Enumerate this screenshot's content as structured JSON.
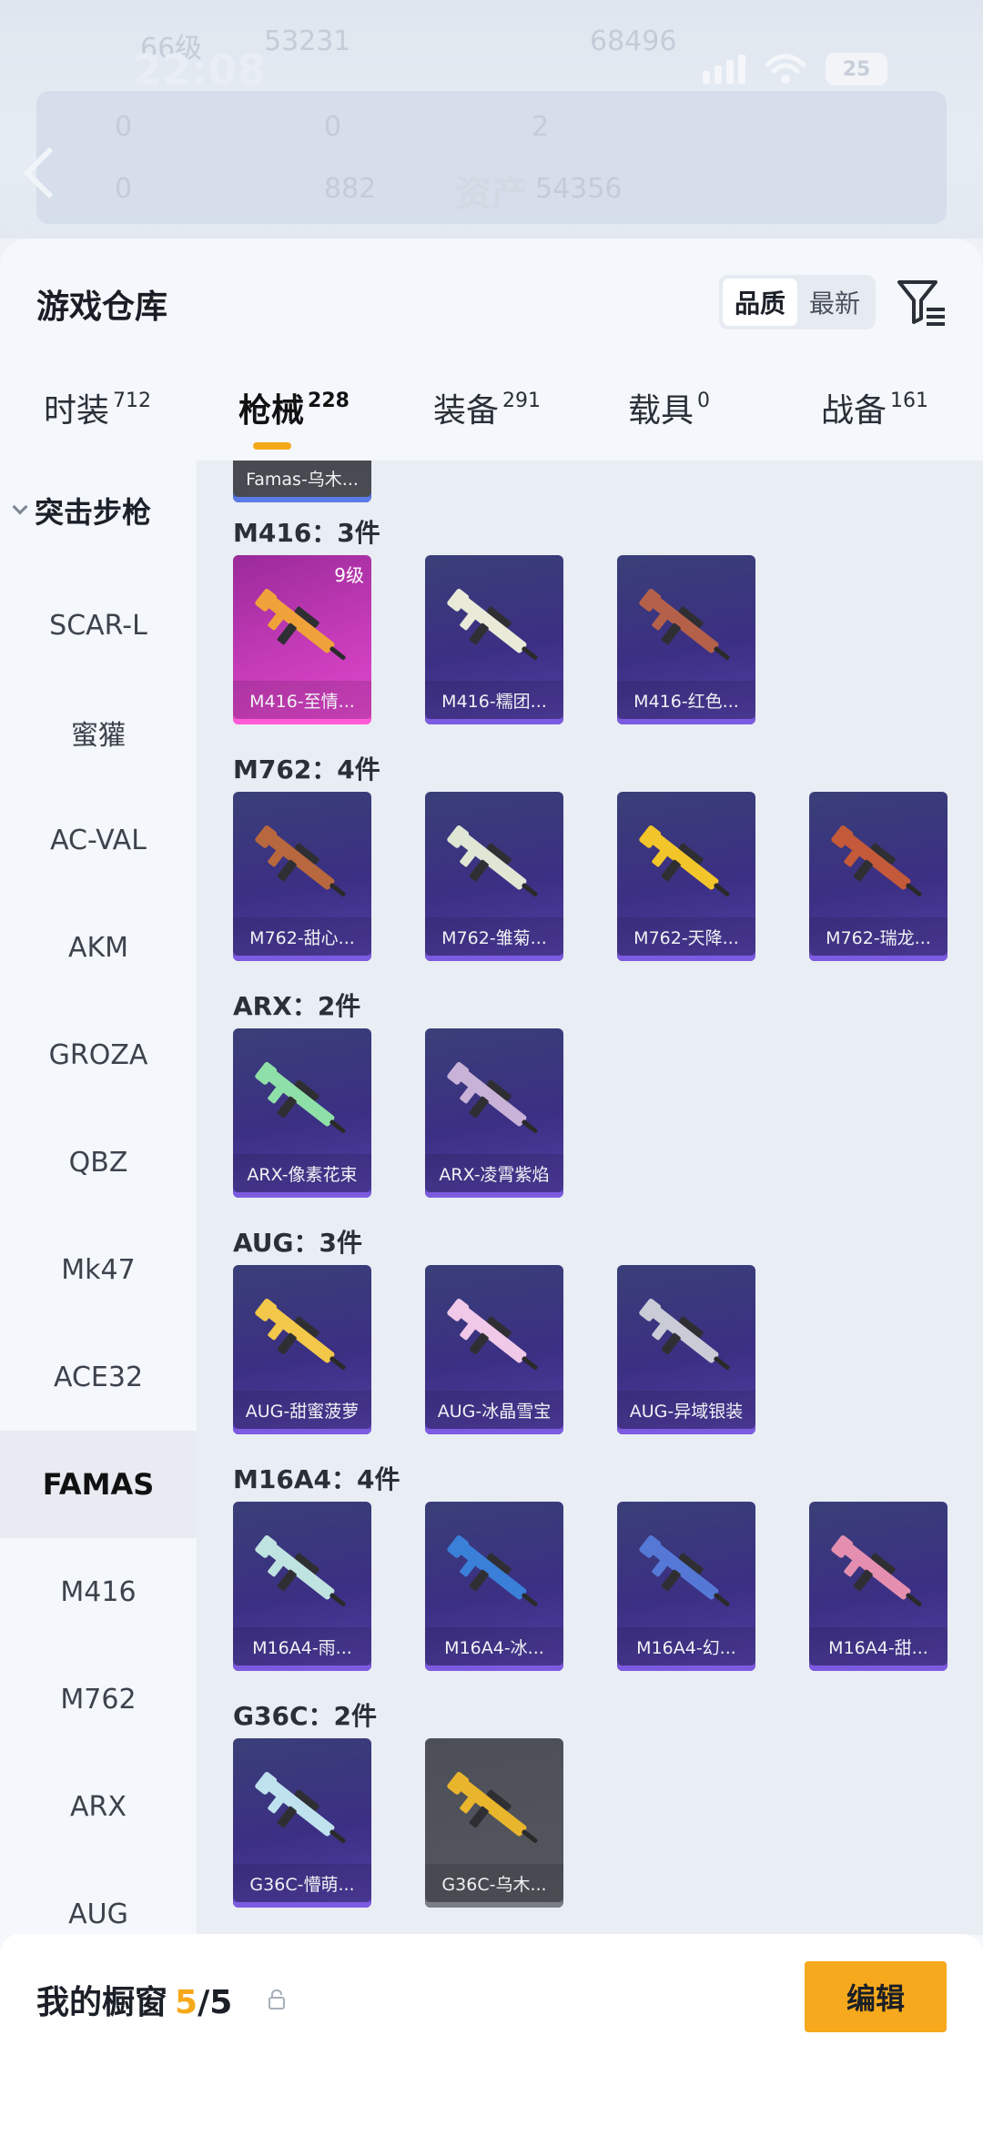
{
  "status_bar": {
    "time": "22:08",
    "battery": "25"
  },
  "backdrop": {
    "level_text": "66级",
    "coins_left": "53231",
    "coins_right": "68496",
    "stat_1": "0",
    "stat_2": "0",
    "stat_3": "2",
    "stat_4": "0",
    "stat_5": "882",
    "assets_label": "资产",
    "assets_value": "54356"
  },
  "header": {
    "title": "游戏仓库",
    "sort_options": [
      "品质",
      "最新"
    ],
    "sort_active": "品质"
  },
  "tabs": [
    {
      "label": "时装",
      "count": "712"
    },
    {
      "label": "枪械",
      "count": "228"
    },
    {
      "label": "装备",
      "count": "291"
    },
    {
      "label": "载具",
      "count": "0"
    },
    {
      "label": "战备",
      "count": "161"
    }
  ],
  "sidebar": {
    "section": "突击步枪",
    "items": [
      "SCAR-L",
      "蜜獾",
      "AC-VAL",
      "AKM",
      "GROZA",
      "QBZ",
      "Mk47",
      "ACE32",
      "FAMAS",
      "M416",
      "M762",
      "ARX",
      "AUG"
    ],
    "active": "FAMAS"
  },
  "content": {
    "partial_top_card": "Famas-乌木...",
    "groups": [
      {
        "title": "M416：3件",
        "items": [
          {
            "name": "M416-至情...",
            "level": "9级",
            "style": "pink",
            "color": "#f0a23a"
          },
          {
            "name": "M416-糯团...",
            "style": "purple",
            "color": "#e9ead8"
          },
          {
            "name": "M416-红色...",
            "style": "purple",
            "color": "#b5614a"
          }
        ]
      },
      {
        "title": "M762：4件",
        "items": [
          {
            "name": "M762-甜心...",
            "style": "purple",
            "color": "#b8683e"
          },
          {
            "name": "M762-雏菊...",
            "style": "purple",
            "color": "#dfe6d4"
          },
          {
            "name": "M762-天降...",
            "style": "purple",
            "color": "#f2c52b"
          },
          {
            "name": "M762-瑞龙...",
            "style": "purple",
            "color": "#c45a3a"
          }
        ]
      },
      {
        "title": "ARX：2件",
        "items": [
          {
            "name": "ARX-像素花束",
            "style": "purple",
            "color": "#8fe0a8"
          },
          {
            "name": "ARX-凌霄紫焰",
            "style": "purple",
            "color": "#c9b2d8"
          }
        ]
      },
      {
        "title": "AUG：3件",
        "items": [
          {
            "name": "AUG-甜蜜菠萝",
            "style": "purple",
            "color": "#f3c74a"
          },
          {
            "name": "AUG-冰晶雪宝",
            "style": "purple",
            "color": "#f0c8e8"
          },
          {
            "name": "AUG-异域银装",
            "style": "purple",
            "color": "#c9ccd6"
          }
        ]
      },
      {
        "title": "M16A4：4件",
        "items": [
          {
            "name": "M16A4-雨...",
            "style": "purple",
            "color": "#bfe3e0"
          },
          {
            "name": "M16A4-冰...",
            "style": "purple",
            "color": "#3a7fd8"
          },
          {
            "name": "M16A4-幻...",
            "style": "purple",
            "color": "#5578d6"
          },
          {
            "name": "M16A4-甜...",
            "style": "purple",
            "color": "#e58fb0"
          }
        ]
      },
      {
        "title": "G36C：2件",
        "items": [
          {
            "name": "G36C-懵萌...",
            "style": "purple",
            "color": "#bfe2ee"
          },
          {
            "name": "G36C-乌木...",
            "style": "grey",
            "color": "#e9b52c"
          }
        ]
      }
    ]
  },
  "bottom": {
    "title": "我的橱窗",
    "count_current": "5",
    "count_total": "/5",
    "edit_label": "编辑"
  },
  "colors": {
    "accent": "#f6a91c",
    "tab_underline": "#f5a91a"
  }
}
